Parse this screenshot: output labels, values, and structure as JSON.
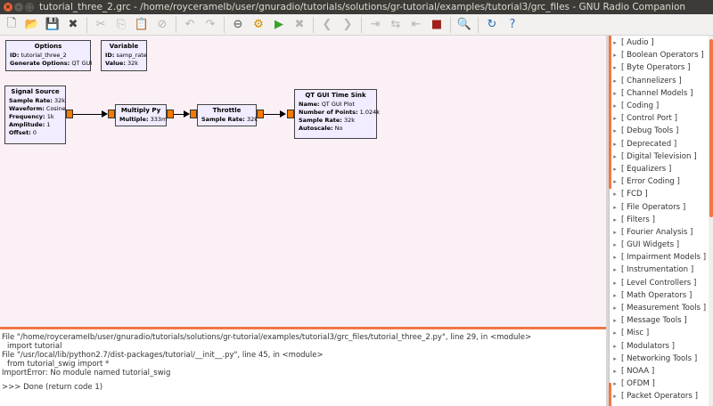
{
  "window": {
    "title": "tutorial_three_2.grc - /home/roycerameIb/user/gnuradio/tutorials/solutions/gr-tutorial/examples/tutorial3/grc_files - GNU Radio Companion"
  },
  "toolbar": {
    "buttons": [
      {
        "name": "new-icon",
        "glyph": "🗋"
      },
      {
        "name": "open-icon",
        "glyph": "📂"
      },
      {
        "name": "save-icon",
        "glyph": "💾"
      },
      {
        "name": "close-icon",
        "glyph": "✖"
      },
      {
        "name": "cut-icon",
        "glyph": "✂"
      },
      {
        "name": "copy-icon",
        "glyph": "⎘"
      },
      {
        "name": "paste-icon",
        "glyph": "📋"
      },
      {
        "name": "delete-icon",
        "glyph": "⊘"
      },
      {
        "name": "undo-icon",
        "glyph": "↶"
      },
      {
        "name": "redo-icon",
        "glyph": "↷"
      },
      {
        "name": "disable-icon",
        "glyph": "⊖"
      },
      {
        "name": "generate-icon",
        "glyph": "⚙"
      },
      {
        "name": "execute-icon",
        "glyph": "▶"
      },
      {
        "name": "kill-icon",
        "glyph": "✖"
      },
      {
        "name": "rotate-left-icon",
        "glyph": "❮"
      },
      {
        "name": "rotate-right-icon",
        "glyph": "❯"
      },
      {
        "name": "enable-icon",
        "glyph": "⇥"
      },
      {
        "name": "bypass-icon",
        "glyph": "⇆"
      },
      {
        "name": "disable-block-icon",
        "glyph": "⇤"
      },
      {
        "name": "stop-icon",
        "glyph": "■"
      },
      {
        "name": "find-icon",
        "glyph": "🔍"
      },
      {
        "name": "reload-icon",
        "glyph": "↻"
      },
      {
        "name": "help-icon",
        "glyph": "?"
      }
    ]
  },
  "canvas": {
    "blocks": {
      "options": {
        "title": "Options",
        "props": [
          {
            "k": "ID:",
            "v": "tutorial_three_2"
          },
          {
            "k": "Generate Options:",
            "v": "QT GUI"
          }
        ]
      },
      "variable": {
        "title": "Variable",
        "props": [
          {
            "k": "ID:",
            "v": "samp_rate"
          },
          {
            "k": "Value:",
            "v": "32k"
          }
        ]
      },
      "signal_source": {
        "title": "Signal Source",
        "props": [
          {
            "k": "Sample Rate:",
            "v": "32k"
          },
          {
            "k": "Waveform:",
            "v": "Cosine"
          },
          {
            "k": "Frequency:",
            "v": "1k"
          },
          {
            "k": "Amplitude:",
            "v": "1"
          },
          {
            "k": "Offset:",
            "v": "0"
          }
        ]
      },
      "multiply_py": {
        "title": "Multiply Py",
        "props": [
          {
            "k": "Multiple:",
            "v": "333m"
          }
        ]
      },
      "throttle": {
        "title": "Throttle",
        "props": [
          {
            "k": "Sample Rate:",
            "v": "32k"
          }
        ]
      },
      "time_sink": {
        "title": "QT GUI Time Sink",
        "props": [
          {
            "k": "Name:",
            "v": "QT GUI Plot"
          },
          {
            "k": "Number of Points:",
            "v": "1.024k"
          },
          {
            "k": "Sample Rate:",
            "v": "32k"
          },
          {
            "k": "Autoscale:",
            "v": "No"
          }
        ]
      }
    },
    "port_color": "#f57a00",
    "background": "#fcf0f7"
  },
  "console": {
    "lines": [
      "File \"/home/roycerameIb/user/gnuradio/tutorials/solutions/gr-tutorial/examples/tutorial3/grc_files/tutorial_three_2.py\", line 29, in <module>",
      "import tutorial",
      "File \"/usr/local/lib/python2.7/dist-packages/tutorial/__init__.py\", line 45, in <module>",
      "from tutorial_swig import *",
      "ImportError: No module named tutorial_swig",
      ">>> Done (return code 1)"
    ]
  },
  "tree": {
    "categories": [
      "[ Audio ]",
      "[ Boolean Operators ]",
      "[ Byte Operators ]",
      "[ Channelizers ]",
      "[ Channel Models ]",
      "[ Coding ]",
      "[ Control Port ]",
      "[ Debug Tools ]",
      "[ Deprecated ]",
      "[ Digital Television ]",
      "[ Equalizers ]",
      "[ Error Coding ]",
      "[ FCD ]",
      "[ File Operators ]",
      "[ Filters ]",
      "[ Fourier Analysis ]",
      "[ GUI Widgets ]",
      "[ Impairment Models ]",
      "[ Instrumentation ]",
      "[ Level Controllers ]",
      "[ Math Operators ]",
      "[ Measurement Tools ]",
      "[ Message Tools ]",
      "[ Misc ]",
      "[ Modulators ]",
      "[ Networking Tools ]",
      "[ NOAA ]",
      "[ OFDM ]",
      "[ Packet Operators ]"
    ],
    "expander_glyph": "▸"
  },
  "colors": {
    "accent": "#f07746",
    "titlebar": "#3c3b37"
  }
}
